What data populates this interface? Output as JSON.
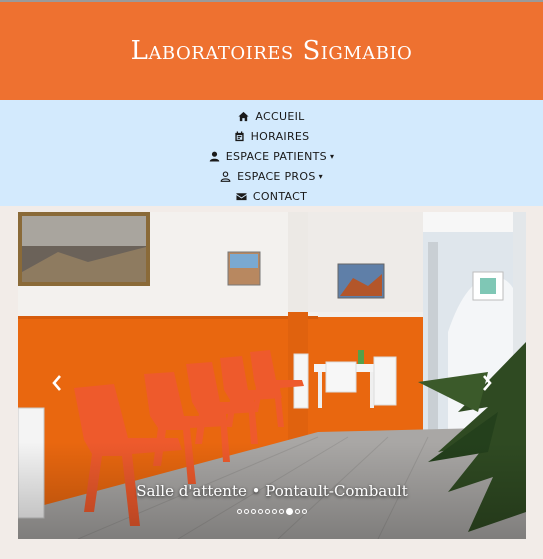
{
  "header": {
    "title": "Laboratoires Sigmabio"
  },
  "nav": {
    "items": [
      {
        "label": "ACCUEIL",
        "icon": "home-icon"
      },
      {
        "label": "HORAIRES",
        "icon": "calendar-icon"
      },
      {
        "label": "ESPACE PATIENTS",
        "icon": "user-solid-icon",
        "caret": "▾"
      },
      {
        "label": "ESPACE PROS",
        "icon": "user-outline-icon",
        "caret": "▾"
      },
      {
        "label": "CONTACT",
        "icon": "envelope-icon"
      }
    ]
  },
  "slider": {
    "caption": "Salle d'attente • Pontault-Combault",
    "slide_count": 10,
    "active_slide": 8
  },
  "colors": {
    "header_bg": "#ee7130",
    "nav_bg": "#d3eafd",
    "page_bg": "#f2ece8"
  }
}
